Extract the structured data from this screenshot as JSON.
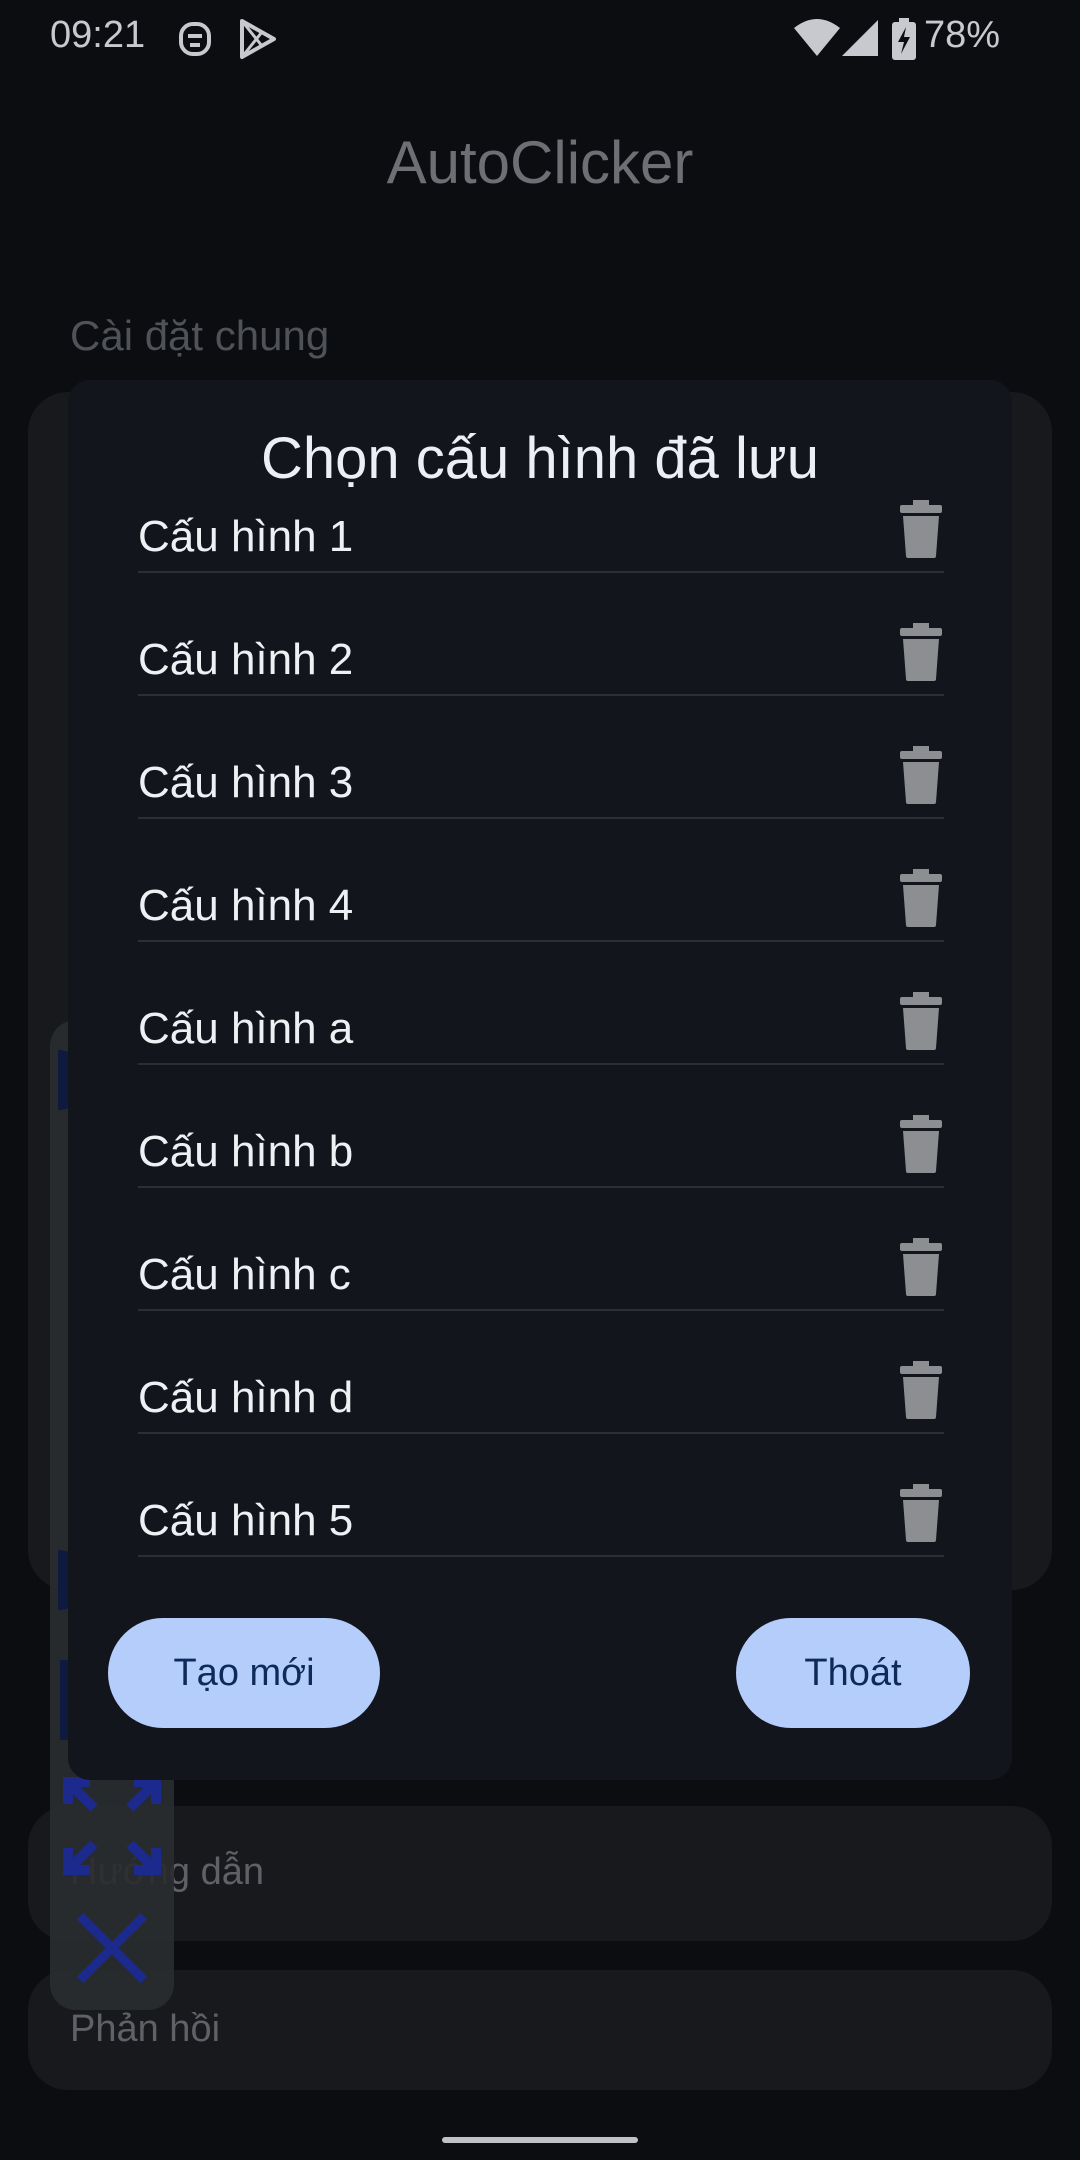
{
  "status_bar": {
    "time": "09:21",
    "battery": "78%",
    "icons": [
      "face-icon",
      "play-store-icon",
      "wifi-icon",
      "signal-icon",
      "battery-charging-icon"
    ]
  },
  "app": {
    "title": "AutoClicker",
    "section_general": "Cài đặt chung",
    "menu": {
      "guide": "Hướng dẫn",
      "feedback": "Phản hồi"
    }
  },
  "dialog": {
    "title": "Chọn cấu hình đã lưu",
    "configs": [
      {
        "name": "Cấu hình 1"
      },
      {
        "name": "Cấu hình 2"
      },
      {
        "name": "Cấu hình 3"
      },
      {
        "name": "Cấu hình 4"
      },
      {
        "name": "Cấu hình a"
      },
      {
        "name": "Cấu hình b"
      },
      {
        "name": "Cấu hình c"
      },
      {
        "name": "Cấu hình d"
      },
      {
        "name": "Cấu hình 5"
      }
    ],
    "new_button": "Tạo mới",
    "exit_button": "Thoát"
  },
  "colors": {
    "accent": "#b5cdfa",
    "dialog_bg": "#12151c",
    "overlay_icon": "#1b2a8c"
  }
}
